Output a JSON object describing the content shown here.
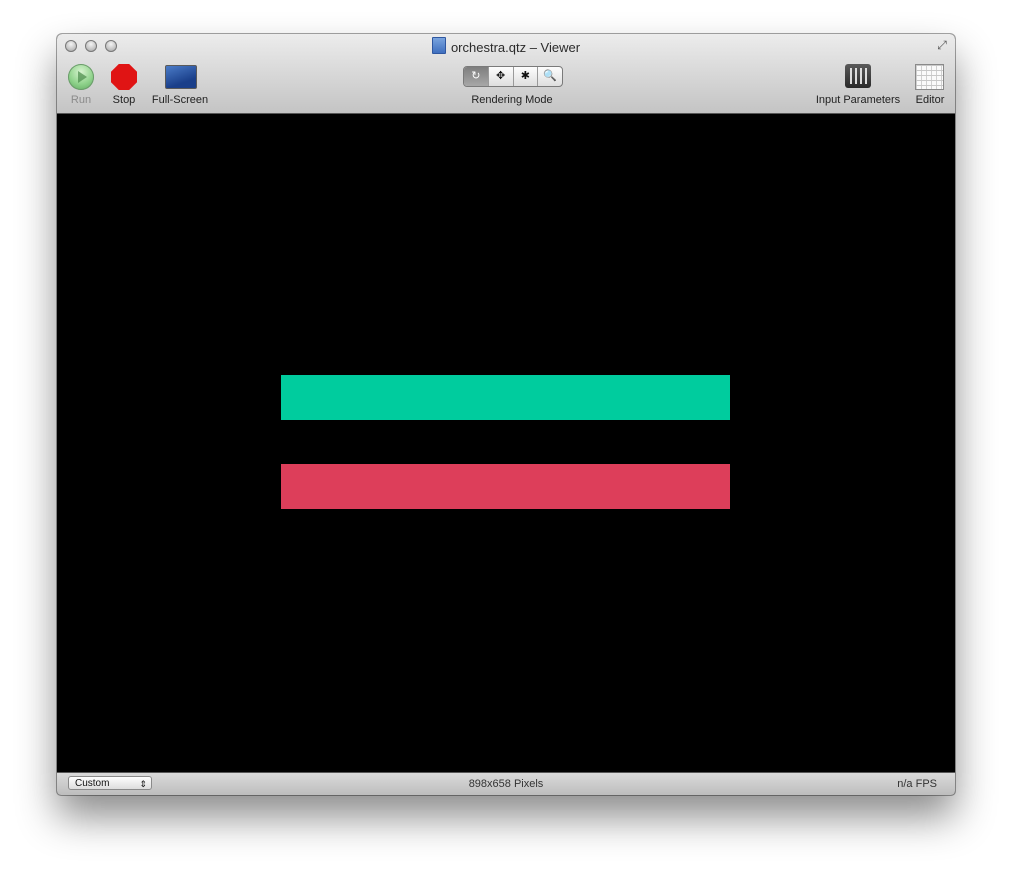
{
  "window": {
    "title": "orchestra.qtz – Viewer"
  },
  "toolbar": {
    "run_label": "Run",
    "stop_label": "Stop",
    "fullscreen_label": "Full-Screen",
    "rendering_mode_label": "Rendering Mode",
    "rendering_modes": [
      "↻",
      "✥",
      "✱",
      "🔍"
    ],
    "input_parameters_label": "Input Parameters",
    "editor_label": "Editor"
  },
  "canvas": {
    "background": "#000000",
    "bars": [
      {
        "name": "teal-bar",
        "color": "#00cc9e"
      },
      {
        "name": "red-bar",
        "color": "#dd3e5a"
      }
    ]
  },
  "status": {
    "size_preset": "Custom",
    "pixels": "898x658 Pixels",
    "fps": "n/a FPS"
  }
}
